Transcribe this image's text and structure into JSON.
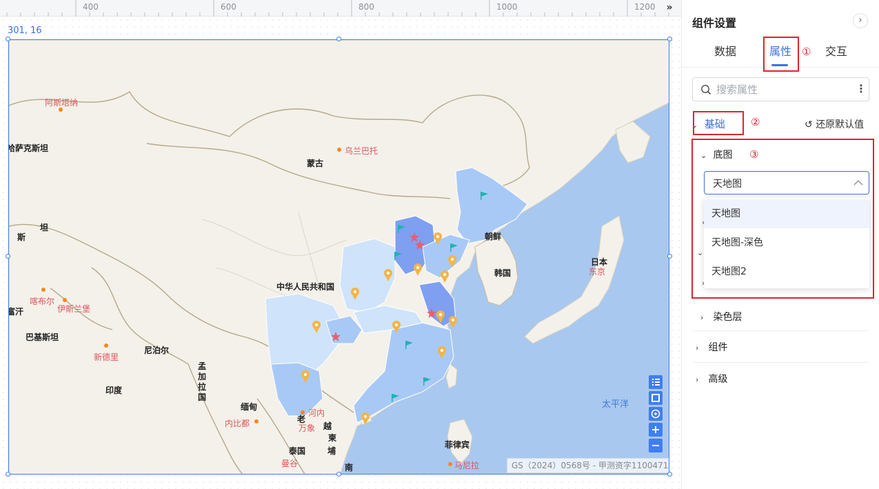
{
  "ruler": {
    "labels": [
      "400",
      "600",
      "800",
      "1000",
      "1200"
    ],
    "expand_glyph": "»"
  },
  "canvas": {
    "coord_label": "301, 16"
  },
  "map": {
    "labels": {
      "astana": "阿斯塔纳",
      "kazakhstan": "哈萨克斯坦",
      "ulaanbaatar": "乌兰巴托",
      "mongolia": "蒙古",
      "korea_north": "朝鲜",
      "korea_south": "韩国",
      "japan": "日本",
      "tokyo": "东京",
      "china": "中华人民共和国",
      "kabul": "喀布尔",
      "islamabad": "伊斯兰堡",
      "afghan_fragment": "富汗",
      "pakistan": "巴基斯坦",
      "new_delhi": "新德里",
      "nepal": "尼泊尔",
      "india": "印度",
      "bangladesh": "孟加拉国",
      "myanmar": "缅甸",
      "naypyidaw": "内比都",
      "laos": "老",
      "vientiane": "万象",
      "hanoi": "河内",
      "vietnam": "越",
      "thailand": "泰国",
      "bangkok": "曼谷",
      "cambodia": "柬",
      "cambodia_2": "埔",
      "south": "南",
      "philippines": "菲律宾",
      "manila": "马尼拉",
      "pacific": "太平洋",
      "tajik_1": "坦",
      "tajik_2": "斯"
    },
    "copyright": "GS（2024）0568号 - 甲测资字1100471",
    "controls": [
      "list-icon",
      "fit-icon",
      "locate-icon",
      "zoom-in-icon",
      "zoom-out-icon"
    ],
    "colors": {
      "sea": "#a9c8ef",
      "land": "#f3f1ea",
      "province_light": "#cfe3fb",
      "province_mid": "#a8c9f6",
      "province_dark": "#7f9ff0",
      "flag": "#20b3b3",
      "pin": "#f4b443",
      "star": "#ef5d6e"
    }
  },
  "panel": {
    "title": "组件设置",
    "tabs": [
      {
        "label": "数据"
      },
      {
        "label": "属性"
      },
      {
        "label": "交互"
      }
    ],
    "annotations": [
      "①",
      "②",
      "③"
    ],
    "search": {
      "placeholder": "搜索属性",
      "value": ""
    },
    "basic": {
      "label": "基础",
      "reset_label": "还原默认值"
    },
    "basemap": {
      "label": "底图",
      "selected": "天地图",
      "options": [
        "天地图",
        "天地图-深色",
        "天地图2"
      ]
    },
    "sections": [
      {
        "label": "染色层"
      },
      {
        "label": "组件"
      },
      {
        "label": "高级"
      }
    ],
    "accent": "#3d6fe0",
    "annotation_color": "#e0232d"
  }
}
